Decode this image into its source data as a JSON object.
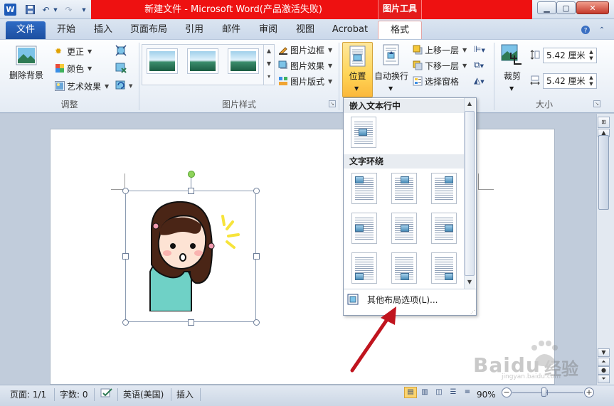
{
  "titlebar": {
    "title": "新建文件 - Microsoft Word(产品激活失败)",
    "context_tab": "图片工具",
    "app_icon": "W"
  },
  "tabs": [
    "文件",
    "开始",
    "插入",
    "页面布局",
    "引用",
    "邮件",
    "审阅",
    "视图",
    "Acrobat",
    "格式"
  ],
  "ribbon": {
    "adjust": {
      "remove_bg": "删除背景",
      "corrections": "更正",
      "color": "颜色",
      "artistic": "艺术效果",
      "label": "调整"
    },
    "styles": {
      "label": "图片样式",
      "border": "图片边框",
      "effects": "图片效果",
      "layout": "图片版式"
    },
    "arrange": {
      "position": "位置",
      "wrap": "自动换行",
      "forward": "上移一层",
      "backward": "下移一层",
      "selection_pane": "选择窗格"
    },
    "size": {
      "crop": "裁剪",
      "height": "5.42 厘米",
      "width": "5.42 厘米",
      "label": "大小"
    }
  },
  "dropdown": {
    "inline_header": "嵌入文本行中",
    "wrap_header": "文字环绕",
    "more": "其他布局选项(L)..."
  },
  "statusbar": {
    "page": "页面: 1/1",
    "words": "字数: 0",
    "lang": "英语(美国)",
    "mode": "插入",
    "zoom": "90%",
    "zoom_value": 90
  },
  "watermark": {
    "brand": "Baidu",
    "product": "经验",
    "url": "jingyan.baidu.com"
  },
  "colors": {
    "title_red": "#ee1111",
    "file_tab": "#1c4fa0",
    "highlight": "#ffd456",
    "arrow": "#c0141e"
  }
}
